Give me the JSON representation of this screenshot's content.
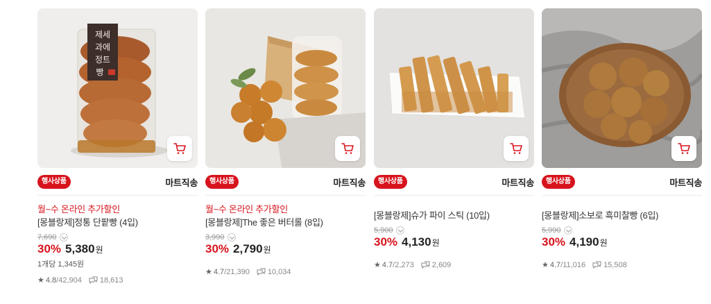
{
  "products": [
    {
      "badge": "행사상품",
      "shipping": "마트직송",
      "promo": "월~수 온라인 추가할인",
      "name": "[몽블랑제]정통 단팥빵 (4입)",
      "original_price": "7,690",
      "discount_rate": "30%",
      "price": "5,380",
      "currency": "원",
      "unit_price": "1개당 1,345원",
      "rating": "4.8",
      "rating_count": "42,904",
      "reviews": "18,613",
      "package_label": "제세과에정트빵",
      "cart_icon": "cart-icon"
    },
    {
      "badge": "행사상품",
      "shipping": "마트직송",
      "promo": "월~수 온라인 추가할인",
      "name": "[몽블랑제]The 좋은 버터롤 (8입)",
      "original_price": "3,990",
      "discount_rate": "30%",
      "price": "2,790",
      "currency": "원",
      "unit_price": "",
      "rating": "4.7",
      "rating_count": "21,390",
      "reviews": "10,034",
      "cart_icon": "cart-icon"
    },
    {
      "badge": "행사상품",
      "shipping": "마트직송",
      "promo": "",
      "name": "[몽블랑제]슈가 파이 스틱 (10입)",
      "original_price": "5,900",
      "discount_rate": "30%",
      "price": "4,130",
      "currency": "원",
      "unit_price": "",
      "rating": "4.7",
      "rating_count": "2,273",
      "reviews": "2,609",
      "cart_icon": "cart-icon"
    },
    {
      "badge": "행사상품",
      "shipping": "마트직송",
      "promo": "",
      "name": "[몽블랑제]소보로 흑미찰빵 (6입)",
      "original_price": "5,990",
      "discount_rate": "30%",
      "price": "4,190",
      "currency": "원",
      "unit_price": "",
      "rating": "4.7",
      "rating_count": "11,016",
      "reviews": "15,508",
      "cart_icon": "cart-icon"
    }
  ],
  "colors": {
    "accent_red": "#d7141d",
    "muted_text": "#999999"
  }
}
